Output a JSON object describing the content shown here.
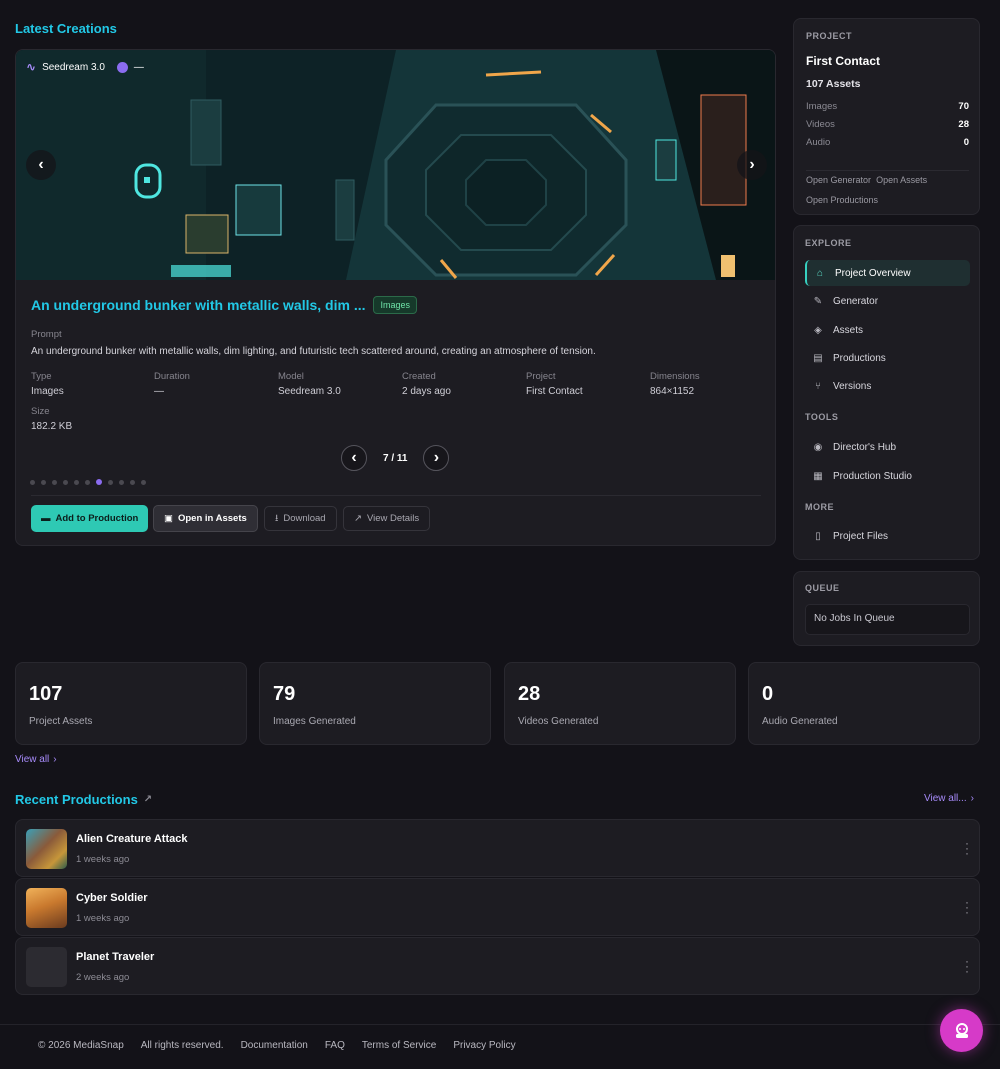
{
  "latest": {
    "heading": "Latest Creations",
    "model_badge": "Seedream 3.0",
    "status_dash": "—",
    "title": "An underground bunker with metallic walls, dim ...",
    "type_badge": "Images",
    "prompt_label": "Prompt",
    "prompt": "An underground bunker with metallic walls, dim lighting, and futuristic tech scattered around, creating an atmosphere of tension.",
    "meta": [
      {
        "label": "Type",
        "value": "Images"
      },
      {
        "label": "Duration",
        "value": "—"
      },
      {
        "label": "Model",
        "value": "Seedream 3.0"
      },
      {
        "label": "Created",
        "value": "2 days ago"
      },
      {
        "label": "Project",
        "value": "First Contact"
      },
      {
        "label": "Dimensions",
        "value": "864×1152"
      },
      {
        "label": "Size",
        "value": "182.2 KB"
      }
    ],
    "pager": "7 / 11",
    "dots_total": 11,
    "dots_active": 7,
    "actions": {
      "add": "Add to Production",
      "open": "Open in Assets",
      "download": "Download",
      "details": "View Details"
    }
  },
  "project": {
    "label": "PROJECT",
    "name": "First Contact",
    "assets": "107 Assets",
    "rows": [
      {
        "label": "Images",
        "value": "70"
      },
      {
        "label": "Videos",
        "value": "28"
      },
      {
        "label": "Audio",
        "value": "0"
      }
    ],
    "links": [
      "Open Generator",
      "Open Assets",
      "Open Productions"
    ]
  },
  "explore": {
    "label": "EXPLORE",
    "items": [
      {
        "label": "Project Overview",
        "icon": "home-icon"
      },
      {
        "label": "Generator",
        "icon": "wand-icon"
      },
      {
        "label": "Assets",
        "icon": "layers-icon"
      },
      {
        "label": "Productions",
        "icon": "film-icon"
      },
      {
        "label": "Versions",
        "icon": "branch-icon"
      }
    ],
    "tools_label": "TOOLS",
    "tools": [
      {
        "label": "Director's Hub",
        "icon": "compass-icon"
      },
      {
        "label": "Production Studio",
        "icon": "clapper-icon"
      }
    ],
    "more_label": "MORE",
    "more": [
      {
        "label": "Project Files",
        "icon": "file-icon"
      }
    ]
  },
  "queue": {
    "label": "QUEUE",
    "empty": "No Jobs In Queue"
  },
  "stats": [
    {
      "value": "107",
      "label": "Project Assets"
    },
    {
      "value": "79",
      "label": "Images Generated"
    },
    {
      "value": "28",
      "label": "Videos Generated"
    },
    {
      "value": "0",
      "label": "Audio Generated"
    }
  ],
  "view_all": "View all",
  "productions": {
    "heading": "Recent Productions",
    "view_all": "View all...",
    "items": [
      {
        "title": "Alien Creature Attack",
        "time": "1 weeks ago"
      },
      {
        "title": "Cyber Soldier",
        "time": "1 weeks ago"
      },
      {
        "title": "Planet Traveler",
        "time": "2 weeks ago"
      }
    ]
  },
  "footer": {
    "copyright": "© 2026 MediaSnap",
    "rights": "All rights reserved.",
    "links": [
      "Documentation",
      "FAQ",
      "Terms of Service",
      "Privacy Policy"
    ]
  },
  "colors": {
    "accent_cyan": "#22c8e6",
    "accent_teal": "#2ec9b4",
    "accent_purple": "#8b6cf0",
    "fab_pink": "#d63ac8"
  }
}
